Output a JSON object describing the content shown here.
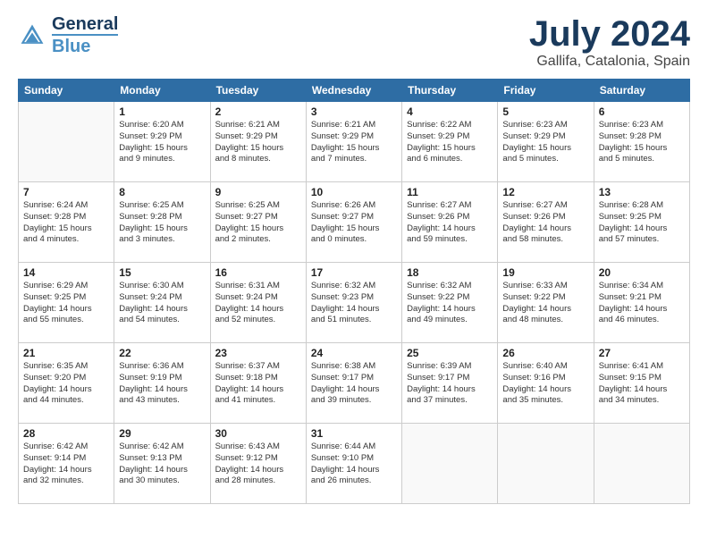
{
  "header": {
    "logo_general": "General",
    "logo_blue": "Blue",
    "month": "July 2024",
    "location": "Gallifa, Catalonia, Spain"
  },
  "columns": [
    "Sunday",
    "Monday",
    "Tuesday",
    "Wednesday",
    "Thursday",
    "Friday",
    "Saturday"
  ],
  "weeks": [
    [
      {
        "day": "",
        "info": ""
      },
      {
        "day": "1",
        "info": "Sunrise: 6:20 AM\nSunset: 9:29 PM\nDaylight: 15 hours\nand 9 minutes."
      },
      {
        "day": "2",
        "info": "Sunrise: 6:21 AM\nSunset: 9:29 PM\nDaylight: 15 hours\nand 8 minutes."
      },
      {
        "day": "3",
        "info": "Sunrise: 6:21 AM\nSunset: 9:29 PM\nDaylight: 15 hours\nand 7 minutes."
      },
      {
        "day": "4",
        "info": "Sunrise: 6:22 AM\nSunset: 9:29 PM\nDaylight: 15 hours\nand 6 minutes."
      },
      {
        "day": "5",
        "info": "Sunrise: 6:23 AM\nSunset: 9:29 PM\nDaylight: 15 hours\nand 5 minutes."
      },
      {
        "day": "6",
        "info": "Sunrise: 6:23 AM\nSunset: 9:28 PM\nDaylight: 15 hours\nand 5 minutes."
      }
    ],
    [
      {
        "day": "7",
        "info": "Sunrise: 6:24 AM\nSunset: 9:28 PM\nDaylight: 15 hours\nand 4 minutes."
      },
      {
        "day": "8",
        "info": "Sunrise: 6:25 AM\nSunset: 9:28 PM\nDaylight: 15 hours\nand 3 minutes."
      },
      {
        "day": "9",
        "info": "Sunrise: 6:25 AM\nSunset: 9:27 PM\nDaylight: 15 hours\nand 2 minutes."
      },
      {
        "day": "10",
        "info": "Sunrise: 6:26 AM\nSunset: 9:27 PM\nDaylight: 15 hours\nand 0 minutes."
      },
      {
        "day": "11",
        "info": "Sunrise: 6:27 AM\nSunset: 9:26 PM\nDaylight: 14 hours\nand 59 minutes."
      },
      {
        "day": "12",
        "info": "Sunrise: 6:27 AM\nSunset: 9:26 PM\nDaylight: 14 hours\nand 58 minutes."
      },
      {
        "day": "13",
        "info": "Sunrise: 6:28 AM\nSunset: 9:25 PM\nDaylight: 14 hours\nand 57 minutes."
      }
    ],
    [
      {
        "day": "14",
        "info": "Sunrise: 6:29 AM\nSunset: 9:25 PM\nDaylight: 14 hours\nand 55 minutes."
      },
      {
        "day": "15",
        "info": "Sunrise: 6:30 AM\nSunset: 9:24 PM\nDaylight: 14 hours\nand 54 minutes."
      },
      {
        "day": "16",
        "info": "Sunrise: 6:31 AM\nSunset: 9:24 PM\nDaylight: 14 hours\nand 52 minutes."
      },
      {
        "day": "17",
        "info": "Sunrise: 6:32 AM\nSunset: 9:23 PM\nDaylight: 14 hours\nand 51 minutes."
      },
      {
        "day": "18",
        "info": "Sunrise: 6:32 AM\nSunset: 9:22 PM\nDaylight: 14 hours\nand 49 minutes."
      },
      {
        "day": "19",
        "info": "Sunrise: 6:33 AM\nSunset: 9:22 PM\nDaylight: 14 hours\nand 48 minutes."
      },
      {
        "day": "20",
        "info": "Sunrise: 6:34 AM\nSunset: 9:21 PM\nDaylight: 14 hours\nand 46 minutes."
      }
    ],
    [
      {
        "day": "21",
        "info": "Sunrise: 6:35 AM\nSunset: 9:20 PM\nDaylight: 14 hours\nand 44 minutes."
      },
      {
        "day": "22",
        "info": "Sunrise: 6:36 AM\nSunset: 9:19 PM\nDaylight: 14 hours\nand 43 minutes."
      },
      {
        "day": "23",
        "info": "Sunrise: 6:37 AM\nSunset: 9:18 PM\nDaylight: 14 hours\nand 41 minutes."
      },
      {
        "day": "24",
        "info": "Sunrise: 6:38 AM\nSunset: 9:17 PM\nDaylight: 14 hours\nand 39 minutes."
      },
      {
        "day": "25",
        "info": "Sunrise: 6:39 AM\nSunset: 9:17 PM\nDaylight: 14 hours\nand 37 minutes."
      },
      {
        "day": "26",
        "info": "Sunrise: 6:40 AM\nSunset: 9:16 PM\nDaylight: 14 hours\nand 35 minutes."
      },
      {
        "day": "27",
        "info": "Sunrise: 6:41 AM\nSunset: 9:15 PM\nDaylight: 14 hours\nand 34 minutes."
      }
    ],
    [
      {
        "day": "28",
        "info": "Sunrise: 6:42 AM\nSunset: 9:14 PM\nDaylight: 14 hours\nand 32 minutes."
      },
      {
        "day": "29",
        "info": "Sunrise: 6:42 AM\nSunset: 9:13 PM\nDaylight: 14 hours\nand 30 minutes."
      },
      {
        "day": "30",
        "info": "Sunrise: 6:43 AM\nSunset: 9:12 PM\nDaylight: 14 hours\nand 28 minutes."
      },
      {
        "day": "31",
        "info": "Sunrise: 6:44 AM\nSunset: 9:10 PM\nDaylight: 14 hours\nand 26 minutes."
      },
      {
        "day": "",
        "info": ""
      },
      {
        "day": "",
        "info": ""
      },
      {
        "day": "",
        "info": ""
      }
    ]
  ]
}
